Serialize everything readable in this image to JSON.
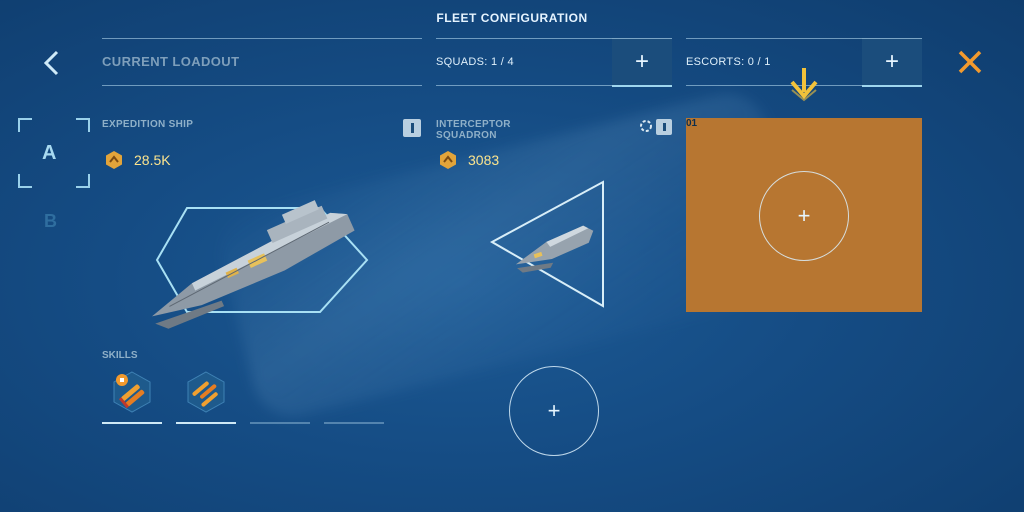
{
  "header": {
    "title": "FLEET CONFIGURATION",
    "current_loadout": "CURRENT LOADOUT",
    "squads_label": "SQUADS: 1 / 4",
    "escorts_label": "ESCORTS: 0 / 1",
    "add_symbol": "+"
  },
  "loadout_slots": {
    "selected": "A",
    "other": "B"
  },
  "expedition_ship": {
    "label": "EXPEDITION SHIP",
    "cost": "28.5K"
  },
  "interceptor": {
    "label_line1": "INTERCEPTOR",
    "label_line2": "SQUADRON",
    "cost": "3083"
  },
  "escort_slot": {
    "number": "01",
    "add_symbol": "+"
  },
  "squad_slot": {
    "add_symbol": "+"
  },
  "skills": {
    "label": "SKILLS",
    "icons": [
      "missile-barrage-icon",
      "missile-swarm-icon"
    ],
    "slot_states": [
      "filled",
      "filled",
      "empty",
      "empty"
    ]
  },
  "colors": {
    "accent_orange": "#f29a2e",
    "slot_orange": "#b77631",
    "cost_yellow": "#fbe48e",
    "line_cyan": "#9fd6ee"
  }
}
